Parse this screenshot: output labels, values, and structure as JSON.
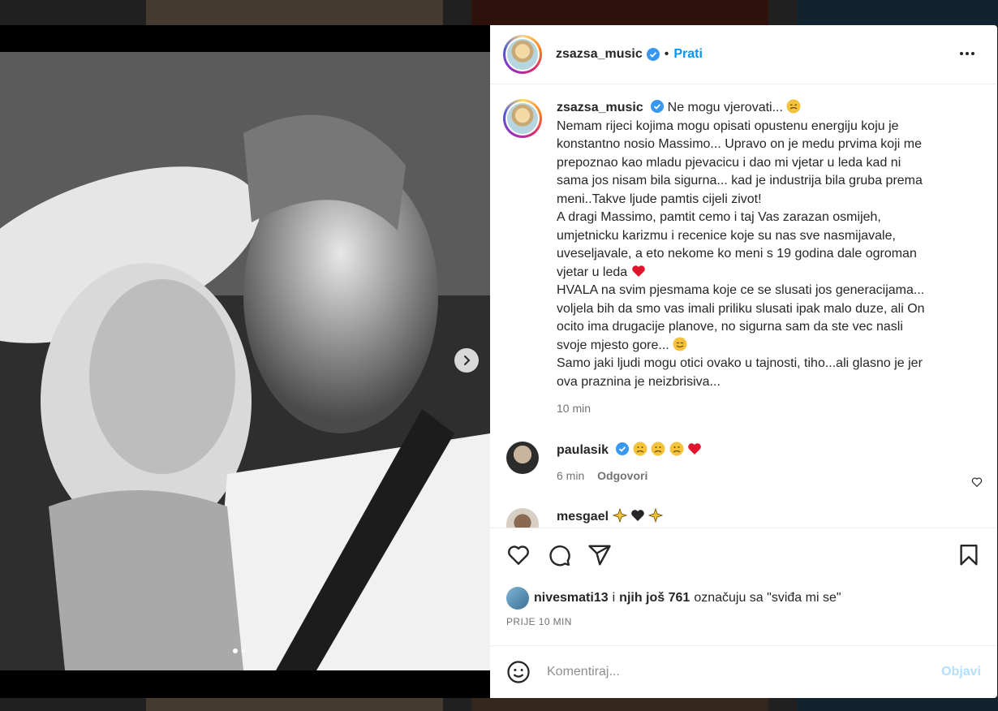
{
  "post": {
    "username": "zsazsa_music",
    "separator": "•",
    "follow_label": "Prati",
    "caption_first": "Ne mogu vjerovati...",
    "caption_lines": [
      "Nemam rijeci kojima mogu opisati opustenu energiju koju je",
      "konstantno nosio Massimo... Upravo on je medu prvima koji me",
      "prepoznao kao mladu pjevacicu i dao mi vjetar u leda kad ni",
      "sama jos nisam bila sigurna... kad je industrija bila gruba prema",
      "meni..Takve ljude pamtis cijeli zivot!",
      "A dragi Massimo, pamtit cemo i taj Vas zarazan osmijeh,",
      "umjetnicku karizmu i recenice koje su nas sve nasmijavale,",
      "uveseljavale, a eto nekome ko meni s 19 godina dale ogroman",
      "vjetar u leda",
      "HVALA na svim pjesmama koje ce se slusati jos generacijama...",
      "voljela bih da smo vas imali priliku slusati ipak malo duze, ali On",
      "ocito ima drugacije planove, no sigurna sam da ste vec nasli",
      "svoje mjesto gore...",
      "Samo jaki ljudi mogu otici ovako u tajnosti, tiho...ali glasno je jer",
      "ova praznina je neizbrisiva..."
    ],
    "caption_time": "10 min"
  },
  "comments": [
    {
      "username": "paulasik",
      "time": "6 min",
      "reply_label": "Odgovori"
    },
    {
      "username": "mesgael"
    }
  ],
  "likes": {
    "user": "nivesmati13",
    "connector": "i",
    "others": "njih još 761",
    "suffix": "označuju sa \"sviđa mi se\""
  },
  "posted_ago": "PRIJE 10 MIN",
  "composer": {
    "placeholder": "Komentiraj...",
    "post_label": "Objavi"
  },
  "colors": {
    "accent": "#0095f6",
    "verified": "#3897f0",
    "heart_red": "#e0152c"
  },
  "icons": [
    "more-icon",
    "verified-icon",
    "next-arrow-icon",
    "like-icon",
    "comment-icon",
    "share-icon",
    "bookmark-icon",
    "emoji-icon",
    "heart-icon"
  ]
}
